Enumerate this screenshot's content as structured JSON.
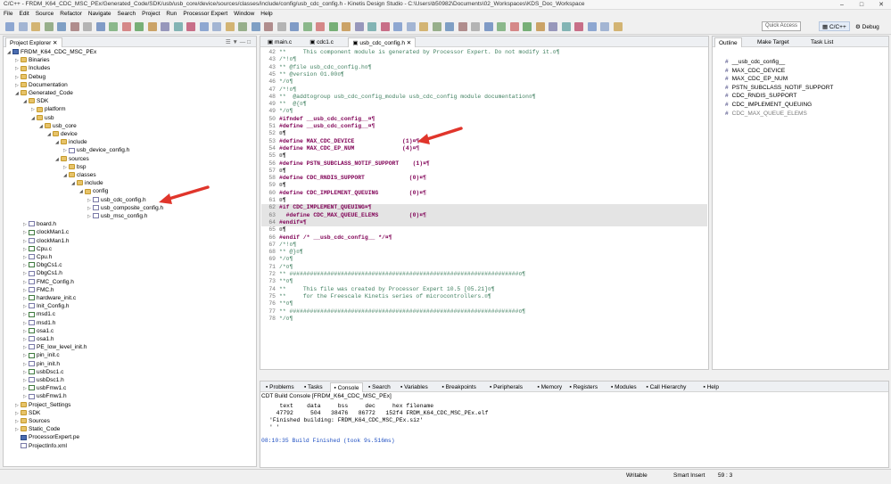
{
  "window": {
    "title": "C/C++ - FRDM_K64_CDC_MSC_PEx/Generated_Code/SDK/usb/usb_core/device/sources/classes/include/config/usb_cdc_config.h - Kinetis Design Studio - C:\\Users\\b50982\\Documents\\02_Workspaces\\KDS_Doc_Workspace"
  },
  "menu": [
    "File",
    "Edit",
    "Source",
    "Refactor",
    "Navigate",
    "Search",
    "Project",
    "Run",
    "Processor Expert",
    "Window",
    "Help"
  ],
  "toolbar": {
    "quick_access": "Quick Access",
    "perspective_cpp": "C/C++",
    "perspective_debug": "Debug"
  },
  "project_explorer": {
    "tab": "Project Explorer",
    "tree": [
      {
        "label": "FRDM_K64_CDC_MSC_PEx",
        "depth": 0,
        "icon": "project",
        "arrow": "v"
      },
      {
        "label": "Binaries",
        "depth": 1,
        "icon": "folder",
        "arrow": ">"
      },
      {
        "label": "Includes",
        "depth": 1,
        "icon": "folder",
        "arrow": ">"
      },
      {
        "label": "Debug",
        "depth": 1,
        "icon": "folder",
        "arrow": ">"
      },
      {
        "label": "Documentation",
        "depth": 1,
        "icon": "folder",
        "arrow": ">"
      },
      {
        "label": "Generated_Code",
        "depth": 1,
        "icon": "folder",
        "arrow": "v"
      },
      {
        "label": "SDK",
        "depth": 2,
        "icon": "folder",
        "arrow": "v"
      },
      {
        "label": "platform",
        "depth": 3,
        "icon": "folder",
        "arrow": ">"
      },
      {
        "label": "usb",
        "depth": 3,
        "icon": "folder",
        "arrow": "v"
      },
      {
        "label": "usb_core",
        "depth": 4,
        "icon": "folder",
        "arrow": "v"
      },
      {
        "label": "device",
        "depth": 5,
        "icon": "folder",
        "arrow": "v"
      },
      {
        "label": "include",
        "depth": 6,
        "icon": "folder",
        "arrow": "v"
      },
      {
        "label": "usb_device_config.h",
        "depth": 7,
        "icon": "h",
        "arrow": ">"
      },
      {
        "label": "sources",
        "depth": 6,
        "icon": "folder",
        "arrow": "v"
      },
      {
        "label": "bsp",
        "depth": 7,
        "icon": "folder",
        "arrow": ">"
      },
      {
        "label": "classes",
        "depth": 7,
        "icon": "folder",
        "arrow": "v"
      },
      {
        "label": "include",
        "depth": 8,
        "icon": "folder",
        "arrow": "v"
      },
      {
        "label": "config",
        "depth": 9,
        "icon": "folder",
        "arrow": "v"
      },
      {
        "label": "usb_cdc_config.h",
        "depth": 10,
        "icon": "h",
        "arrow": ">"
      },
      {
        "label": "usb_composite_config.h",
        "depth": 10,
        "icon": "h",
        "arrow": ">"
      },
      {
        "label": "usb_msc_config.h",
        "depth": 10,
        "icon": "h",
        "arrow": ">"
      },
      {
        "label": "board.h",
        "depth": 2,
        "icon": "h",
        "arrow": ">"
      },
      {
        "label": "clockMan1.c",
        "depth": 2,
        "icon": "c",
        "arrow": ">"
      },
      {
        "label": "clockMan1.h",
        "depth": 2,
        "icon": "h",
        "arrow": ">"
      },
      {
        "label": "Cpu.c",
        "depth": 2,
        "icon": "c",
        "arrow": ">"
      },
      {
        "label": "Cpu.h",
        "depth": 2,
        "icon": "h",
        "arrow": ">"
      },
      {
        "label": "DbgCs1.c",
        "depth": 2,
        "icon": "c",
        "arrow": ">"
      },
      {
        "label": "DbgCs1.h",
        "depth": 2,
        "icon": "h",
        "arrow": ">"
      },
      {
        "label": "FMC_Config.h",
        "depth": 2,
        "icon": "h",
        "arrow": ">"
      },
      {
        "label": "FMC.h",
        "depth": 2,
        "icon": "h",
        "arrow": ">"
      },
      {
        "label": "hardware_init.c",
        "depth": 2,
        "icon": "c",
        "arrow": ">"
      },
      {
        "label": "Init_Config.h",
        "depth": 2,
        "icon": "h",
        "arrow": ">"
      },
      {
        "label": "msd1.c",
        "depth": 2,
        "icon": "c",
        "arrow": ">"
      },
      {
        "label": "msd1.h",
        "depth": 2,
        "icon": "h",
        "arrow": ">"
      },
      {
        "label": "osa1.c",
        "depth": 2,
        "icon": "c",
        "arrow": ">"
      },
      {
        "label": "osa1.h",
        "depth": 2,
        "icon": "h",
        "arrow": ">"
      },
      {
        "label": "PE_low_level_init.h",
        "depth": 2,
        "icon": "h",
        "arrow": ">"
      },
      {
        "label": "pin_init.c",
        "depth": 2,
        "icon": "c",
        "arrow": ">"
      },
      {
        "label": "pin_init.h",
        "depth": 2,
        "icon": "h",
        "arrow": ">"
      },
      {
        "label": "usbDsc1.c",
        "depth": 2,
        "icon": "c",
        "arrow": ">"
      },
      {
        "label": "usbDsc1.h",
        "depth": 2,
        "icon": "h",
        "arrow": ">"
      },
      {
        "label": "usbFmw1.c",
        "depth": 2,
        "icon": "c",
        "arrow": ">"
      },
      {
        "label": "usbFmw1.h",
        "depth": 2,
        "icon": "h",
        "arrow": ">"
      },
      {
        "label": "Project_Settings",
        "depth": 1,
        "icon": "folder",
        "arrow": ">"
      },
      {
        "label": "SDK",
        "depth": 1,
        "icon": "folder",
        "arrow": ">"
      },
      {
        "label": "Sources",
        "depth": 1,
        "icon": "folder",
        "arrow": ">"
      },
      {
        "label": "Static_Code",
        "depth": 1,
        "icon": "folder",
        "arrow": ">"
      },
      {
        "label": "ProcessorExpert.pe",
        "depth": 1,
        "icon": "pe",
        "arrow": ""
      },
      {
        "label": "ProjectInfo.xml",
        "depth": 1,
        "icon": "xml",
        "arrow": ""
      }
    ]
  },
  "editor": {
    "tabs": [
      "main.c",
      "cdc1.c",
      "usb_cdc_config.h"
    ],
    "active_tab": 2,
    "lines": [
      {
        "n": "42",
        "t": "**     This component module is generated by Processor Expert. Do not modify it.¤¶",
        "k": "cm"
      },
      {
        "n": "43",
        "t": "/*!¤¶",
        "k": "cm"
      },
      {
        "n": "43",
        "t": "** @file usb_cdc_config.h¤¶",
        "k": "cm"
      },
      {
        "n": "45",
        "t": "** @version 01.00¤¶",
        "k": "cm"
      },
      {
        "n": "46",
        "t": "*/¤¶",
        "k": "cm"
      },
      {
        "n": "47",
        "t": "/*!¤¶",
        "k": "cm"
      },
      {
        "n": "48",
        "t": "**  @addtogroup usb_cdc_config_module usb_cdc_config module documentation¤¶",
        "k": "cm"
      },
      {
        "n": "49",
        "t": "**  @{¤¶",
        "k": "cm"
      },
      {
        "n": "49",
        "t": "*/¤¶",
        "k": "cm"
      },
      {
        "n": "50",
        "t": "#ifndef __usb_cdc_config__¤¶",
        "k": "pp"
      },
      {
        "n": "51",
        "t": "#define __usb_cdc_config__¤¶",
        "k": "pp"
      },
      {
        "n": "52",
        "t": "¤¶",
        "k": ""
      },
      {
        "n": "53",
        "t": "#define MAX_CDC_DEVICE              (1)¤¶",
        "k": "pp"
      },
      {
        "n": "54",
        "t": "#define MAX_CDC_EP_NUM              (4)¤¶",
        "k": "pp"
      },
      {
        "n": "55",
        "t": "¤¶",
        "k": ""
      },
      {
        "n": "56",
        "t": "#define PSTN_SUBCLASS_NOTIF_SUPPORT    (1)¤¶",
        "k": "pp"
      },
      {
        "n": "57",
        "t": "¤¶",
        "k": ""
      },
      {
        "n": "58",
        "t": "#define CDC_RNDIS_SUPPORT             (0)¤¶",
        "k": "pp"
      },
      {
        "n": "59",
        "t": "¤¶",
        "k": ""
      },
      {
        "n": "60",
        "t": "#define CDC_IMPLEMENT_QUEUING         (0)¤¶",
        "k": "pp"
      },
      {
        "n": "61",
        "t": "¤¶",
        "k": ""
      },
      {
        "n": "62",
        "t": "#if CDC_IMPLEMENT_QUEUING¤¶",
        "k": "pp hl"
      },
      {
        "n": "63",
        "t": "  #define CDC_MAX_QUEUE_ELEMS         (0)¤¶",
        "k": "pp hl"
      },
      {
        "n": "64",
        "t": "#endif¤¶",
        "k": "pp hl"
      },
      {
        "n": "65",
        "t": "¤¶",
        "k": ""
      },
      {
        "n": "66",
        "t": "#endif /* __usb_cdc_config__ */¤¶",
        "k": "pp"
      },
      {
        "n": "67",
        "t": "/*!¤¶",
        "k": "cm"
      },
      {
        "n": "68",
        "t": "** @}¤¶",
        "k": "cm"
      },
      {
        "n": "69",
        "t": "*/¤¶",
        "k": "cm"
      },
      {
        "n": "71",
        "t": "/*¤¶",
        "k": "cm"
      },
      {
        "n": "72",
        "t": "** ###################################################################¤¶",
        "k": "cm"
      },
      {
        "n": "73",
        "t": "**¤¶",
        "k": "cm"
      },
      {
        "n": "74",
        "t": "**     This file was created by Processor Expert 10.5 [05.21]¤¶",
        "k": "cm"
      },
      {
        "n": "75",
        "t": "**     for the Freescale Kinetis series of microcontrollers.¤¶",
        "k": "cm"
      },
      {
        "n": "76",
        "t": "**¤¶",
        "k": "cm"
      },
      {
        "n": "77",
        "t": "** ###################################################################¤¶",
        "k": "cm"
      },
      {
        "n": "78",
        "t": "*/¤¶",
        "k": "cm"
      }
    ]
  },
  "outline": {
    "tabs": [
      "Outline",
      "Make Target",
      "Task List"
    ],
    "items": [
      "__usb_cdc_config__",
      "MAX_CDC_DEVICE",
      "MAX_CDC_EP_NUM",
      "PSTN_SUBCLASS_NOTIF_SUPPORT",
      "CDC_RNDIS_SUPPORT",
      "CDC_IMPLEMENT_QUEUING",
      "CDC_MAX_QUEUE_ELEMS"
    ]
  },
  "bottom": {
    "tabs": [
      "Problems",
      "Tasks",
      "Console",
      "Search",
      "Variables",
      "Breakpoints",
      "Peripherals",
      "Memory",
      "Registers",
      "Modules",
      "Call Hierarchy",
      "Help"
    ],
    "active_tab": 2,
    "console_title": "CDT Build Console [FRDM_K64_CDC_MSC_PEx]",
    "lines": [
      "   text    data     bss     dec     hex filename",
      "  47792     504   38476   86772   152f4 FRDM_K64_CDC_MSC_PEx.elf",
      "'Finished building: FRDM_K64_CDC_MSC_PEx.siz'",
      "' '"
    ],
    "finished": "08:10:35 Build Finished (took 9s.516ms)"
  },
  "status": {
    "writable": "Writable",
    "insert": "Smart Insert",
    "position": "59 : 3"
  }
}
